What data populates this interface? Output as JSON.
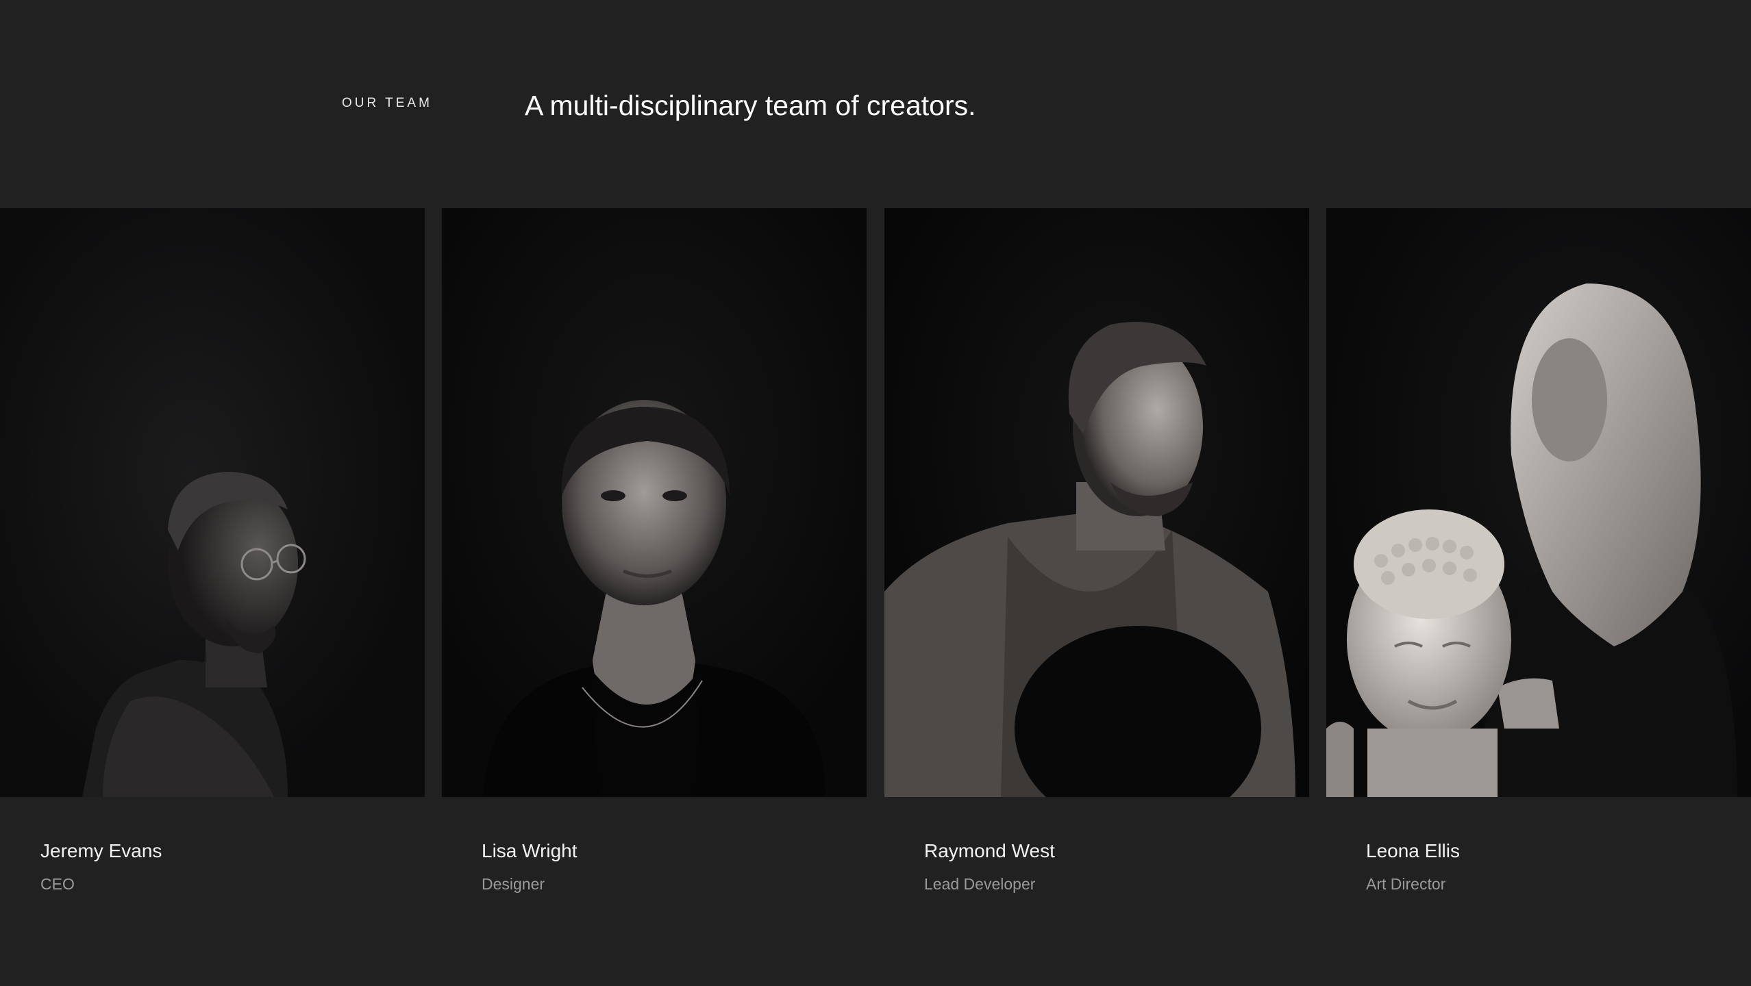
{
  "section": {
    "eyebrow": "OUR TEAM",
    "headline": "A multi-disciplinary team of creators."
  },
  "team": [
    {
      "name": "Jeremy Evans",
      "role": "CEO",
      "photo_icon": "portrait-man-glasses"
    },
    {
      "name": "Lisa Wright",
      "role": "Designer",
      "photo_icon": "portrait-woman-short-hair"
    },
    {
      "name": "Raymond West",
      "role": "Lead Developer",
      "photo_icon": "portrait-man-hat"
    },
    {
      "name": "Leona Ellis",
      "role": "Art Director",
      "photo_icon": "portrait-woman-buddha-bust"
    }
  ],
  "colors": {
    "background": "#212121",
    "photo_background": "#0c0c0d",
    "name_text": "#f2f2f2",
    "role_text": "#9a9a9a"
  }
}
